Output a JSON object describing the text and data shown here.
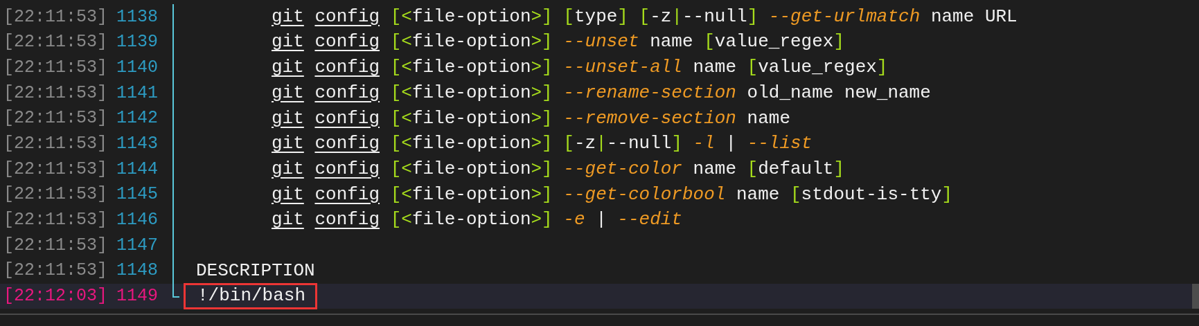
{
  "lines": [
    {
      "time": "[22:11:53]",
      "number": "1138",
      "selected": false,
      "kind": "synopsis",
      "segments": [
        {
          "kind": "link",
          "text": "git config "
        },
        {
          "kind": "bracket",
          "text": "[<"
        },
        {
          "kind": "plain",
          "text": "file-option"
        },
        {
          "kind": "bracket",
          "text": ">] ["
        },
        {
          "kind": "plain",
          "text": "type"
        },
        {
          "kind": "bracket",
          "text": "] ["
        },
        {
          "kind": "plain",
          "text": "-z"
        },
        {
          "kind": "bracket",
          "text": "|"
        },
        {
          "kind": "plain",
          "text": "--null"
        },
        {
          "kind": "bracket",
          "text": "] "
        },
        {
          "kind": "option",
          "text": "--get-urlmatch"
        },
        {
          "kind": "plain",
          "text": " name URL"
        }
      ]
    },
    {
      "time": "[22:11:53]",
      "number": "1139",
      "selected": false,
      "kind": "synopsis",
      "segments": [
        {
          "kind": "link",
          "text": "git config "
        },
        {
          "kind": "bracket",
          "text": "[<"
        },
        {
          "kind": "plain",
          "text": "file-option"
        },
        {
          "kind": "bracket",
          "text": ">] "
        },
        {
          "kind": "option",
          "text": "--unset"
        },
        {
          "kind": "plain",
          "text": " name "
        },
        {
          "kind": "bracket",
          "text": "["
        },
        {
          "kind": "plain",
          "text": "value_regex"
        },
        {
          "kind": "bracket",
          "text": "]"
        }
      ]
    },
    {
      "time": "[22:11:53]",
      "number": "1140",
      "selected": false,
      "kind": "synopsis",
      "segments": [
        {
          "kind": "link",
          "text": "git config "
        },
        {
          "kind": "bracket",
          "text": "[<"
        },
        {
          "kind": "plain",
          "text": "file-option"
        },
        {
          "kind": "bracket",
          "text": ">] "
        },
        {
          "kind": "option",
          "text": "--unset-all"
        },
        {
          "kind": "plain",
          "text": " name "
        },
        {
          "kind": "bracket",
          "text": "["
        },
        {
          "kind": "plain",
          "text": "value_regex"
        },
        {
          "kind": "bracket",
          "text": "]"
        }
      ]
    },
    {
      "time": "[22:11:53]",
      "number": "1141",
      "selected": false,
      "kind": "synopsis",
      "segments": [
        {
          "kind": "link",
          "text": "git config "
        },
        {
          "kind": "bracket",
          "text": "[<"
        },
        {
          "kind": "plain",
          "text": "file-option"
        },
        {
          "kind": "bracket",
          "text": ">] "
        },
        {
          "kind": "option",
          "text": "--rename-section"
        },
        {
          "kind": "plain",
          "text": " old_name new_name"
        }
      ]
    },
    {
      "time": "[22:11:53]",
      "number": "1142",
      "selected": false,
      "kind": "synopsis",
      "segments": [
        {
          "kind": "link",
          "text": "git config "
        },
        {
          "kind": "bracket",
          "text": "[<"
        },
        {
          "kind": "plain",
          "text": "file-option"
        },
        {
          "kind": "bracket",
          "text": ">] "
        },
        {
          "kind": "option",
          "text": "--remove-section"
        },
        {
          "kind": "plain",
          "text": " name"
        }
      ]
    },
    {
      "time": "[22:11:53]",
      "number": "1143",
      "selected": false,
      "kind": "synopsis",
      "segments": [
        {
          "kind": "link",
          "text": "git config "
        },
        {
          "kind": "bracket",
          "text": "[<"
        },
        {
          "kind": "plain",
          "text": "file-option"
        },
        {
          "kind": "bracket",
          "text": ">] ["
        },
        {
          "kind": "plain",
          "text": "-z"
        },
        {
          "kind": "bracket",
          "text": "|"
        },
        {
          "kind": "plain",
          "text": "--null"
        },
        {
          "kind": "bracket",
          "text": "] "
        },
        {
          "kind": "option",
          "text": "-l"
        },
        {
          "kind": "plain",
          "text": " | "
        },
        {
          "kind": "option",
          "text": "--list"
        }
      ]
    },
    {
      "time": "[22:11:53]",
      "number": "1144",
      "selected": false,
      "kind": "synopsis",
      "segments": [
        {
          "kind": "link",
          "text": "git config "
        },
        {
          "kind": "bracket",
          "text": "[<"
        },
        {
          "kind": "plain",
          "text": "file-option"
        },
        {
          "kind": "bracket",
          "text": ">] "
        },
        {
          "kind": "option",
          "text": "--get-color"
        },
        {
          "kind": "plain",
          "text": " name "
        },
        {
          "kind": "bracket",
          "text": "["
        },
        {
          "kind": "plain",
          "text": "default"
        },
        {
          "kind": "bracket",
          "text": "]"
        }
      ]
    },
    {
      "time": "[22:11:53]",
      "number": "1145",
      "selected": false,
      "kind": "synopsis",
      "segments": [
        {
          "kind": "link",
          "text": "git config "
        },
        {
          "kind": "bracket",
          "text": "[<"
        },
        {
          "kind": "plain",
          "text": "file-option"
        },
        {
          "kind": "bracket",
          "text": ">] "
        },
        {
          "kind": "option",
          "text": "--get-colorbool"
        },
        {
          "kind": "plain",
          "text": " name "
        },
        {
          "kind": "bracket",
          "text": "["
        },
        {
          "kind": "plain",
          "text": "stdout-is-tty"
        },
        {
          "kind": "bracket",
          "text": "]"
        }
      ]
    },
    {
      "time": "[22:11:53]",
      "number": "1146",
      "selected": false,
      "kind": "synopsis",
      "segments": [
        {
          "kind": "link",
          "text": "git config "
        },
        {
          "kind": "bracket",
          "text": "[<"
        },
        {
          "kind": "plain",
          "text": "file-option"
        },
        {
          "kind": "bracket",
          "text": ">] "
        },
        {
          "kind": "option",
          "text": "-e"
        },
        {
          "kind": "plain",
          "text": " | "
        },
        {
          "kind": "option",
          "text": "--edit"
        }
      ]
    },
    {
      "time": "[22:11:53]",
      "number": "1147",
      "selected": false,
      "kind": "empty"
    },
    {
      "time": "[22:11:53]",
      "number": "1148",
      "selected": false,
      "kind": "heading",
      "segments": [
        {
          "kind": "plain",
          "text": "DESCRIPTION"
        }
      ]
    },
    {
      "time": "[22:12:03]",
      "number": "1149",
      "selected": true,
      "kind": "input",
      "highlighted": true,
      "segments": [
        {
          "kind": "plain",
          "text": "!/bin/bash"
        }
      ]
    }
  ]
}
